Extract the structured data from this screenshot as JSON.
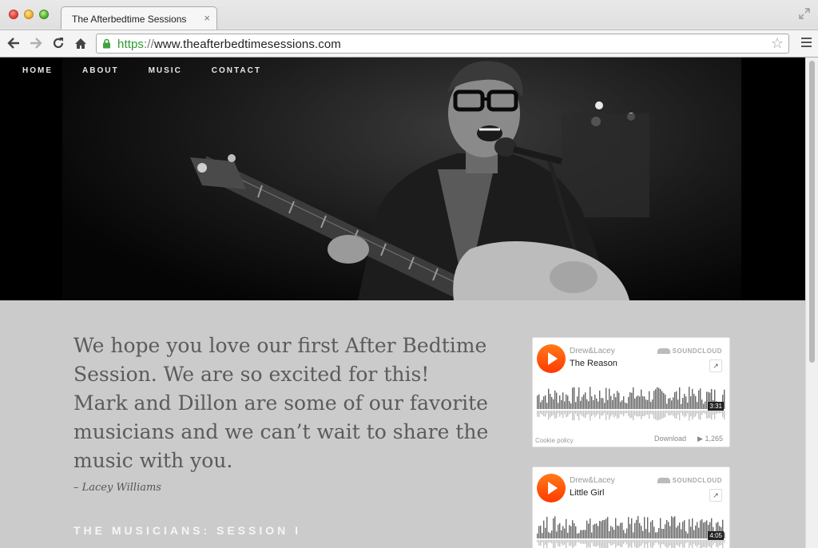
{
  "browser": {
    "tab_title": "The Afterbedtime Sessions",
    "tab_close": "×",
    "url_scheme": "https",
    "url_sep": "://",
    "url_host": "www.theafterbedtimesessions.com",
    "back_icon": "arrow-left-icon",
    "forward_icon": "arrow-right-icon",
    "reload_icon": "reload-icon",
    "home_icon": "home-icon"
  },
  "nav": {
    "items": [
      "HOME",
      "ABOUT",
      "MUSIC",
      "CONTACT"
    ]
  },
  "content": {
    "quote": "We hope you love our first After Bedtime Session. We are so excited for this! Mark and Dillon are some of our favorite musicians and we can’t wait to share the music with you.",
    "attribution": "– Lacey Williams",
    "section_heading": "THE MUSICIANS: SESSION I"
  },
  "players": [
    {
      "artist": "Drew&Lacey",
      "title": "The Reason",
      "brand": "SOUNDCLOUD",
      "duration": "3:31",
      "cookie": "Cookie policy",
      "download": "Download",
      "plays": "▶ 1,265"
    },
    {
      "artist": "Drew&Lacey",
      "title": "Little Girl",
      "brand": "SOUNDCLOUD",
      "duration": "4:05"
    }
  ],
  "colors": {
    "accent": "#ff5500",
    "page_bg": "#cbcbcb",
    "secure_green": "#2f9a2f"
  }
}
